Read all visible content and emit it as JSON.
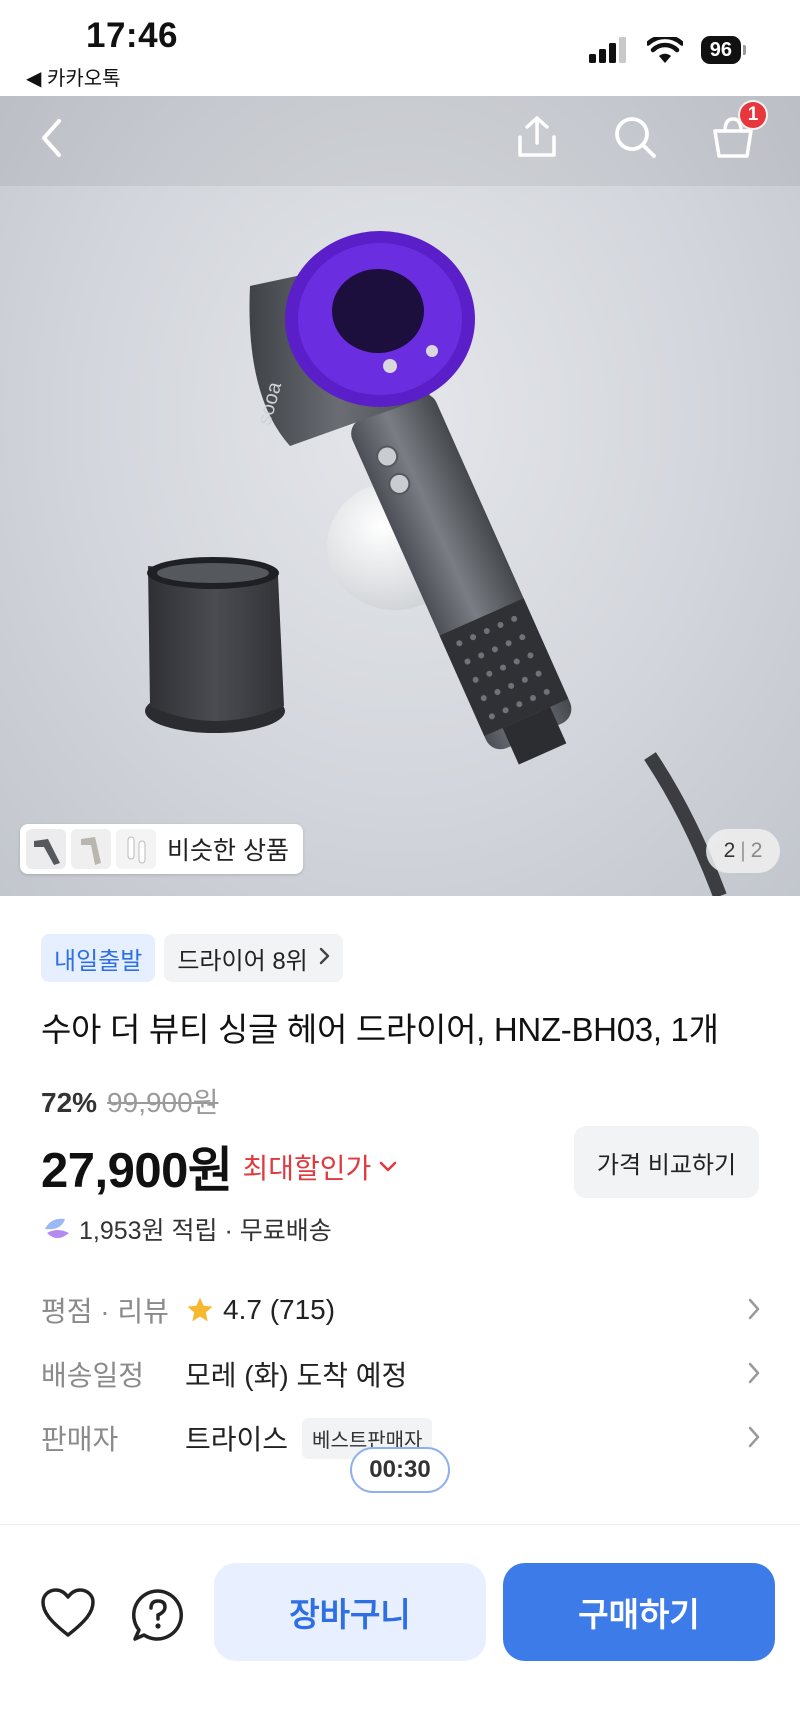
{
  "status_bar": {
    "time": "17:46",
    "back_app": "◀ 카카오톡",
    "battery": "96",
    "icons": [
      "signal-icon",
      "wifi-icon",
      "battery-icon"
    ]
  },
  "nav": {
    "icons": [
      "back-icon",
      "share-icon",
      "search-icon",
      "cart-icon"
    ],
    "cart_count": "1"
  },
  "image": {
    "similar_label": "비슷한 상품",
    "page_current": "2",
    "page_separator": "|",
    "page_total": "2",
    "logo_text": "sooa"
  },
  "product": {
    "chips": {
      "delivery": "내일출발",
      "rank": "드라이어 8위"
    },
    "title": "수아 더 뷰티 싱글 헤어 드라이어, HNZ-BH03, 1개",
    "discount": "72%",
    "original_price": "99,900원",
    "price": "27,900원",
    "max_discount": "최대할인가",
    "compare_button": "가격 비교하기",
    "points": "1,953원 적립 · 무료배송"
  },
  "info": {
    "rating_label": "평점 · 리뷰",
    "rating": "4.7 (715)",
    "shipping_label": "배송일정",
    "shipping": "모레 (화) 도착 예정",
    "seller_label": "판매자",
    "seller": "트라이스",
    "seller_badge": "베스트판매자"
  },
  "timer": "00:30",
  "bottom": {
    "cart_button": "장바구니",
    "buy_button": "구매하기"
  },
  "colors": {
    "accent": "#3d7be8",
    "accent_light": "#e8efff",
    "sale_red": "#e0393e",
    "badge_red": "#e8373c",
    "star": "#f5b82e"
  }
}
